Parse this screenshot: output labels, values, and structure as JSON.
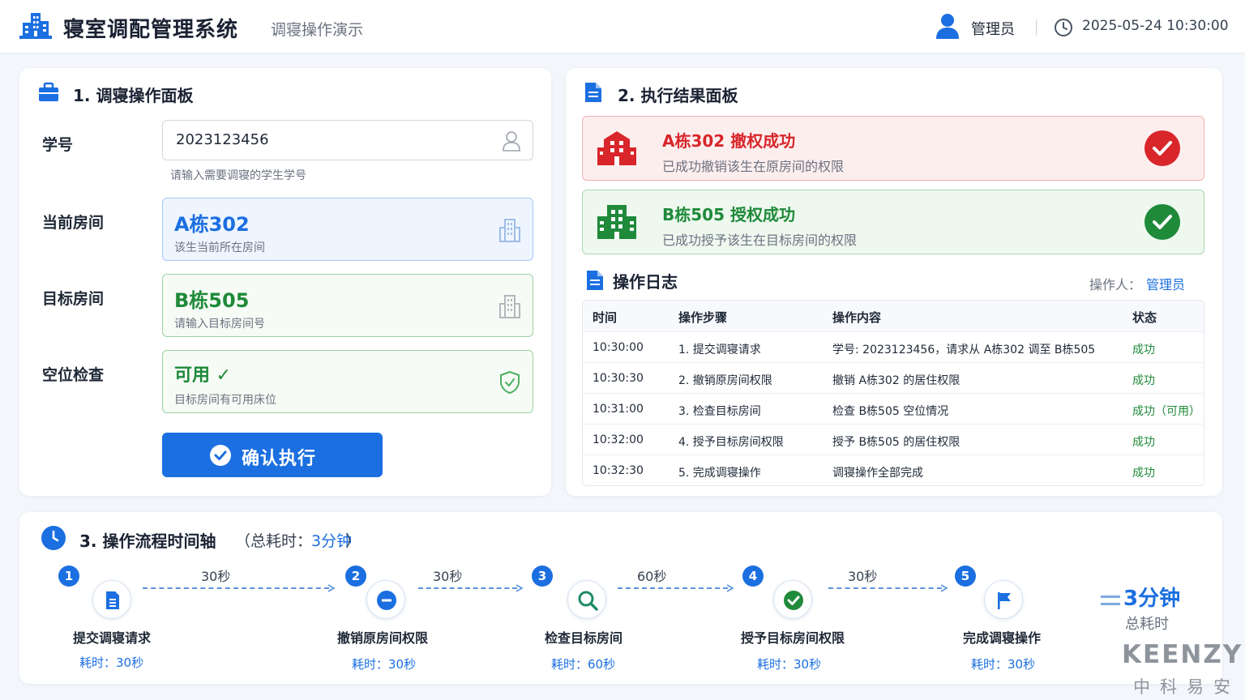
{
  "header": {
    "title": "寝室调配管理系统",
    "subtitle": "调寝操作演示",
    "user": "管理员",
    "datetime": "2025-05-24 10:30:00"
  },
  "operation_panel": {
    "title": "1. 调寝操作面板",
    "student_id": {
      "label": "学号",
      "value": "2023123456",
      "hint": "请输入需要调寝的学生学号"
    },
    "current_room": {
      "label": "当前房间",
      "value": "A栋302",
      "note": "该生当前所在房间"
    },
    "target_room": {
      "label": "目标房间",
      "value": "B栋505",
      "note": "请输入目标房间号"
    },
    "vacancy_check": {
      "label": "空位检查",
      "value": "可用 ✓",
      "note": "目标房间有可用床位"
    },
    "execute_button": "确认执行"
  },
  "result_panel": {
    "title": "2. 执行结果面板",
    "revoke": {
      "title": "A栋302 撤权成功",
      "desc": "已成功撤销该生在原房间的权限"
    },
    "grant": {
      "title": "B栋505 授权成功",
      "desc": "已成功授予该生在目标房间的权限"
    },
    "log": {
      "title": "操作日志",
      "operator_label": "操作人：",
      "operator": "管理员",
      "columns": [
        "时间",
        "操作步骤",
        "操作内容",
        "状态"
      ],
      "rows": [
        [
          "10:30:00",
          "1. 提交调寝请求",
          "学号: 2023123456，请求从 A栋302 调至 B栋505",
          "成功"
        ],
        [
          "10:30:30",
          "2. 撤销原房间权限",
          "撤销 A栋302 的居住权限",
          "成功"
        ],
        [
          "10:31:00",
          "3. 检查目标房间",
          "检查 B栋505 空位情况",
          "成功（可用）"
        ],
        [
          "10:32:00",
          "4. 授予目标房间权限",
          "授予 B栋505 的居住权限",
          "成功"
        ],
        [
          "10:32:30",
          "5. 完成调寝操作",
          "调寝操作全部完成",
          "成功"
        ]
      ]
    }
  },
  "timeline": {
    "title": "3. 操作流程时间轴",
    "total_label": "（总耗时：",
    "total_value": "3分钟",
    "total_close": "）",
    "steps": [
      {
        "num": "1",
        "label": "提交调寝请求",
        "cost": "耗时：30秒",
        "icon": "document-icon"
      },
      {
        "num": "2",
        "label": "撤销原房间权限",
        "cost": "耗时：30秒",
        "icon": "minus-circle-icon"
      },
      {
        "num": "3",
        "label": "检查目标房间",
        "cost": "耗时：60秒",
        "icon": "search-icon"
      },
      {
        "num": "4",
        "label": "授予目标房间权限",
        "cost": "耗时：30秒",
        "icon": "check-circle-icon"
      },
      {
        "num": "5",
        "label": "完成调寝操作",
        "cost": "耗时：30秒",
        "icon": "flag-icon"
      }
    ],
    "connectors": [
      "30秒",
      "30秒",
      "60秒",
      "30秒"
    ],
    "summary_value": "3分钟",
    "summary_label": "总耗时"
  },
  "brand": {
    "name": "KEENZY",
    "sub": "中科易安"
  },
  "colors": {
    "primary": "#1b6fe0",
    "success": "#1f8a3a",
    "danger": "#d8262a"
  }
}
